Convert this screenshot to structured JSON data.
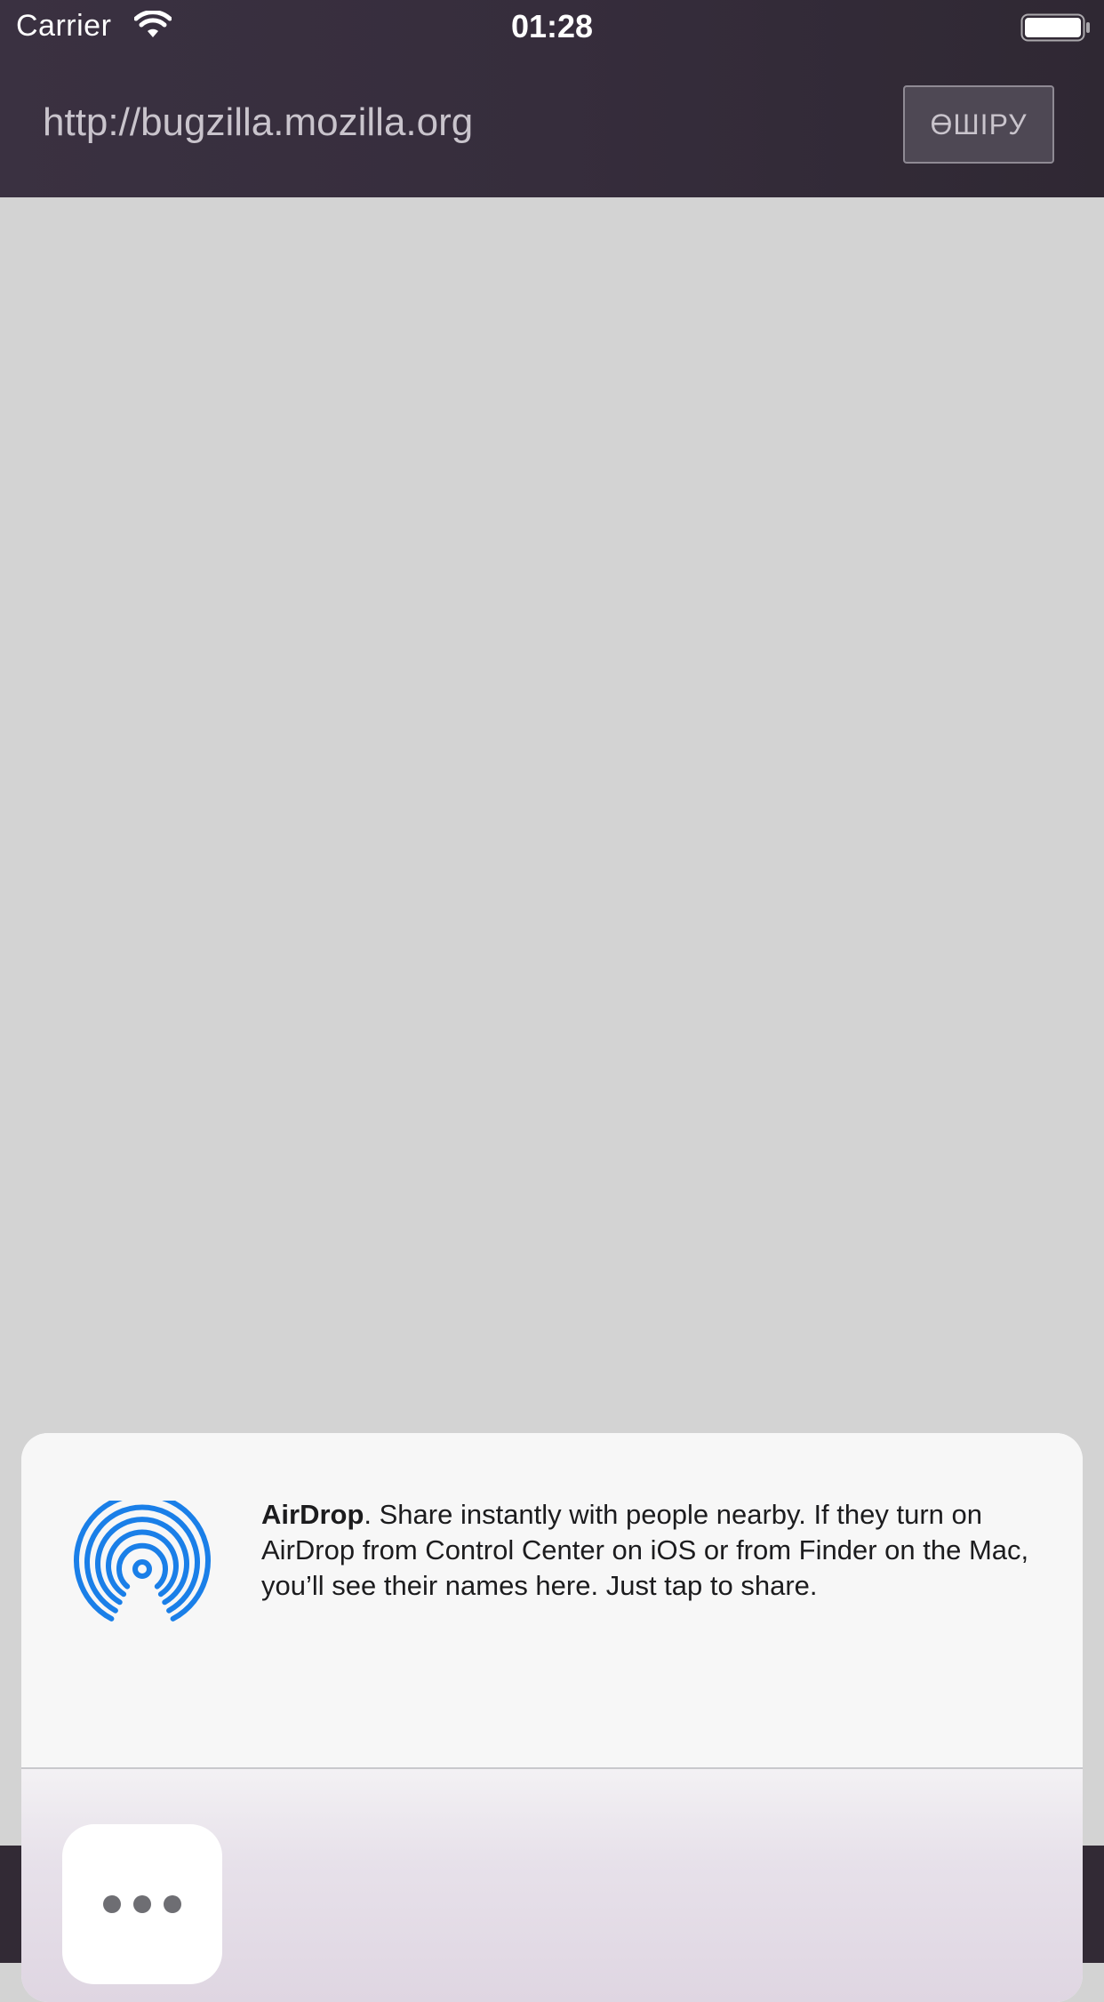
{
  "status_bar": {
    "carrier": "Carrier",
    "time": "01:28"
  },
  "url_bar": {
    "url": "http://bugzilla.mozilla.org",
    "cancel_label": "ӨШІРУ"
  },
  "share_sheet": {
    "airdrop": {
      "title": "AirDrop",
      "description": ". Share instantly with people nearby. If they turn on AirDrop from Control Center on iOS or from Finder on the Mac, you’ll see their names here. Just tap to share."
    },
    "actions": [
      {
        "icon": "more-icon"
      }
    ]
  },
  "colors": {
    "header_bg": "#362d3c",
    "page_bg": "#d3d3d3",
    "airdrop_blue": "#1a7fe8",
    "sheet_bg": "#f7f7f7"
  }
}
